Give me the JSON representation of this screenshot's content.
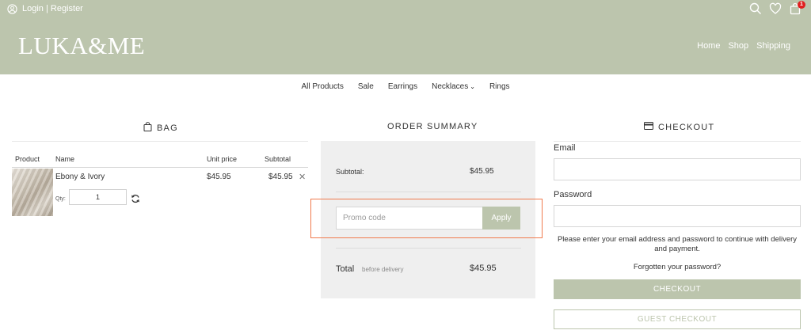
{
  "header": {
    "login_text": "Login | Register",
    "logo": "LUKA&ME",
    "cart_count": "1",
    "nav": [
      "Home",
      "Shop",
      "Shipping"
    ]
  },
  "category_nav": {
    "items": [
      "All Products",
      "Sale",
      "Earrings",
      "Necklaces",
      "Rings"
    ]
  },
  "bag": {
    "title": "BAG",
    "columns": [
      "Product",
      "Name",
      "Unit price",
      "Subtotal"
    ],
    "items": [
      {
        "name": "Ebony & Ivory",
        "unit_price": "$45.95",
        "subtotal": "$45.95",
        "qty_label": "Qty:",
        "qty": "1"
      }
    ]
  },
  "summary": {
    "title": "ORDER SUMMARY",
    "subtotal_label": "Subtotal:",
    "subtotal_value": "$45.95",
    "promo_placeholder": "Promo code",
    "apply_label": "Apply",
    "total_label": "Total",
    "total_sub": "before delivery",
    "total_value": "$45.95"
  },
  "checkout": {
    "title": "CHECKOUT",
    "email_label": "Email",
    "password_label": "Password",
    "note": "Please enter your email address and password to continue with delivery and payment.",
    "forgot": "Forgotten your password?",
    "checkout_button": "CHECKOUT",
    "guest_button": "GUEST CHECKOUT"
  },
  "colors": {
    "brand": "#bcc5ad",
    "promo_highlight": "#f07a4d",
    "badge": "#e02020"
  }
}
